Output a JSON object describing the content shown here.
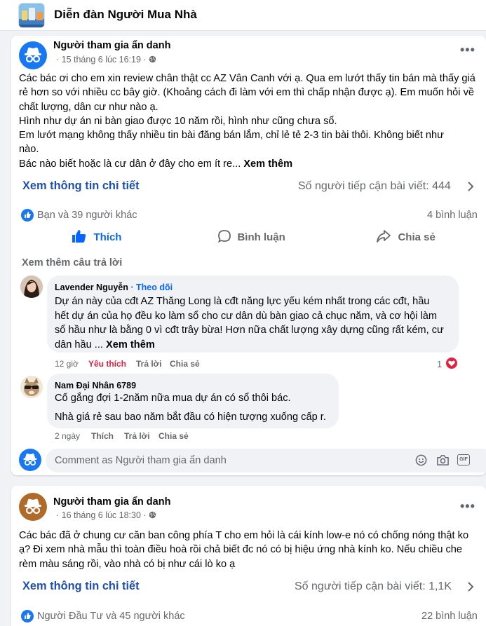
{
  "group": {
    "name": "Diễn đàn Người Mua Nhà"
  },
  "post1": {
    "author": "Người tham gia ẩn danh",
    "time": "· 15 tháng 6 lúc 16:19 ·",
    "body_lines": [
      "Các bác ơi cho em xin review chân thật cc AZ Vân Canh với ạ. Qua em lướt thấy tin bán mà thấy giá",
      "rẻ hơn so với nhiều cc bây giờ. (Khoảng cách đi làm với em thì chấp nhận được ạ). Em muốn hỏi về",
      "chất lượng, dân cư như nào ạ.",
      "Hình như dự án ni bàn giao được 10 năm rồi, hình như cũng chưa sổ.",
      "Em lướt mạng không thấy nhiều tin bài đăng bán lắm, chỉ lẻ tẻ 2-3 tin bài thôi. Không biết như",
      "nào.",
      "Bác nào biết hoặc là cư dân ở đây cho em ít re..."
    ],
    "see_more": "Xem thêm",
    "detail_link": "Xem thông tin chi tiết",
    "reach": "Số người tiếp cận bài viết: 444",
    "reactions": "Bạn và 39 người khác",
    "comments_count": "4 bình luận",
    "actions": {
      "like": "Thích",
      "comment": "Bình luận",
      "share": "Chia sẻ"
    },
    "more_replies": "Xem thêm câu trả lời",
    "comments": [
      {
        "author": "Lavender Nguyễn",
        "follow": "· Theo dõi",
        "lines": [
          "Dự án này của cđt AZ Thăng Long là cđt năng lực yếu kém nhất trong các cđt, hầu",
          "hết dự án của họ đều ko làm sổ cho cư dân dù bàn giao cả chục năm, và cơ hội làm",
          "sổ hầu như là bằng 0 vì cđt trây bừa! Hơn nữa chất lượng xây dựng cũng rất kém, cư",
          "dân hầu ..."
        ],
        "see_more": "Xem thêm",
        "time": "12 giờ",
        "like_label": "Yêu thích",
        "reply": "Trả lời",
        "share": "Chia sẻ",
        "reaction_count": "1"
      },
      {
        "author": "Nam Đại Nhân 6789",
        "lines": [
          "Cố gắng đợi 1-2năm nữa mua dự án có sổ thôi bác.",
          "Nhà giá rẻ sau bao năm bắt đầu có hiện tượng xuống cấp r."
        ],
        "time": "2 ngày",
        "like_label": "Thích",
        "reply": "Trả lời",
        "share": "Chia sẻ"
      }
    ],
    "comment_placeholder": "Comment as Người tham gia ẩn danh",
    "gif_label": "GIF"
  },
  "post2": {
    "author": "Người tham gia ẩn danh",
    "time": "· 16 tháng 6 lúc 18:30 ·",
    "body_lines": [
      "Các bác đã ở chung cư căn ban công phía T cho em hỏi là cái kính low-e nó có chống nóng thật ko",
      "ạ? Đi xem nhà mẫu thì toàn điều hoà rồi chả biết đc nó có bị hiệu ứng nhà kính ko. Nếu chiều che",
      "rèm màu sáng rồi, vào nhà có bị như cái lò ko ạ"
    ],
    "detail_link": "Xem thông tin chi tiết",
    "reach": "Số người tiếp cận bài viết: 1,1K",
    "reactions": "Người Đầu Tư và 45 người khác",
    "comments_count": "22 bình luận"
  },
  "colors": {
    "link_blue": "#1f4fb5",
    "fb_blue": "#0866ff",
    "love_red": "#e41e3f",
    "anon_blue": "#1877f2",
    "anon_brown": "#b06b2b"
  }
}
